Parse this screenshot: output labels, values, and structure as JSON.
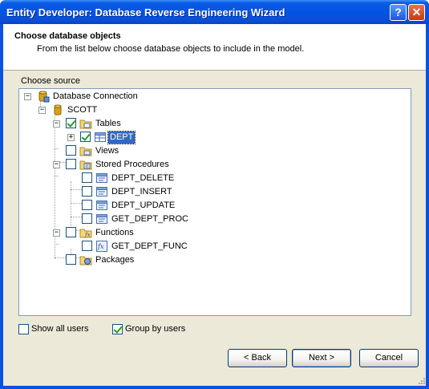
{
  "window": {
    "title": "Entity Developer: Database Reverse Engineering Wizard"
  },
  "header": {
    "title": "Choose database objects",
    "subtitle": "From the list below choose database objects to include in the model."
  },
  "source": {
    "label": "Choose source"
  },
  "tree": {
    "root": "Database Connection",
    "schema": "SCOTT",
    "tables": "Tables",
    "dept": "DEPT",
    "views": "Views",
    "procedures": "Stored Procedures",
    "procs": [
      "DEPT_DELETE",
      "DEPT_INSERT",
      "DEPT_UPDATE",
      "GET_DEPT_PROC"
    ],
    "functions": "Functions",
    "func": "GET_DEPT_FUNC",
    "packages": "Packages"
  },
  "options": {
    "show_all_users": "Show all users",
    "show_all_users_checked": false,
    "group_by_users": "Group by users",
    "group_by_users_checked": true
  },
  "buttons": {
    "back": "< Back",
    "next": "Next >",
    "cancel": "Cancel"
  },
  "colors": {
    "selection": "#316ac5",
    "titlebar": "#0553e3",
    "dialog": "#ece9d8"
  }
}
